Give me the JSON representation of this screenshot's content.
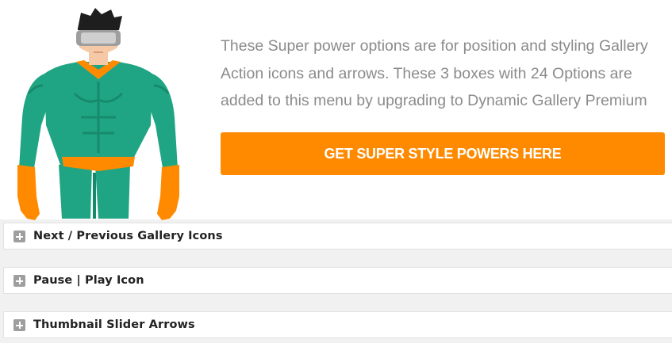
{
  "promo": {
    "text": "These Super power options are for position and styling Gallery Action icons and arrows. These 3 boxes with 24 Options are added to this menu by upgrading to Dynamic Gallery Premium",
    "cta_label": "GET SUPER STYLE POWERS HERE"
  },
  "panels": [
    {
      "title": "Next / Previous Gallery Icons",
      "icon": "plus-icon"
    },
    {
      "title": "Pause | Play Icon",
      "icon": "plus-icon"
    },
    {
      "title": "Thumbnail Slider Arrows",
      "icon": "plus-icon"
    }
  ],
  "colors": {
    "accent": "#ff8a00",
    "text_muted": "#8b8b8b",
    "suit": "#1fa583",
    "suit_dark": "#178a6c",
    "background": "#f1f1f1"
  }
}
